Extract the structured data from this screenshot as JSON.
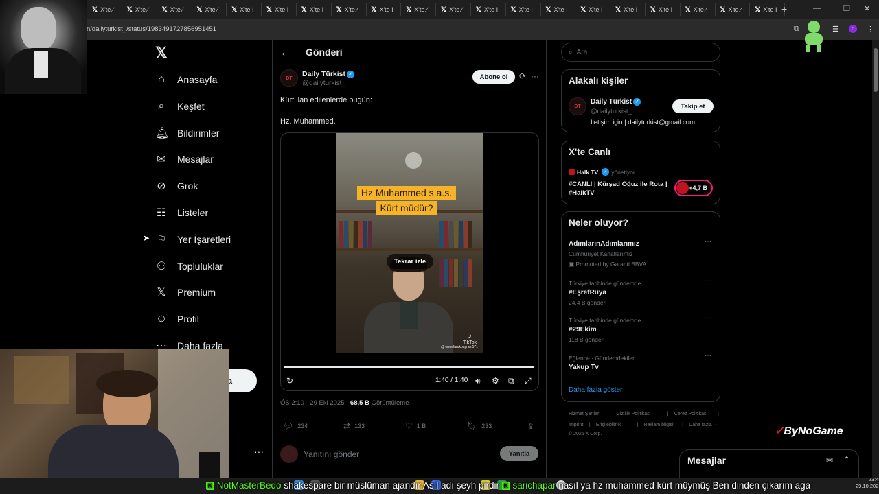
{
  "browser": {
    "tabs": [
      {
        "label": "X'te ∕"
      },
      {
        "label": "X'te ∕"
      },
      {
        "label": "X'te ∕"
      },
      {
        "label": "X'te ∕"
      },
      {
        "label": "X'te I"
      },
      {
        "label": "X'te I"
      },
      {
        "label": "X'te I"
      },
      {
        "label": "X'te ∕"
      },
      {
        "label": "X'te I"
      },
      {
        "label": "X'te ∕"
      },
      {
        "label": "X'te ∕"
      },
      {
        "label": "X'te I"
      },
      {
        "label": "X'te I"
      },
      {
        "label": "X'te I"
      },
      {
        "label": "X'te I"
      },
      {
        "label": "X'te I"
      },
      {
        "label": "X'te I"
      },
      {
        "label": "X'te ∕"
      },
      {
        "label": "X'te ∕"
      },
      {
        "label": "X'te I"
      }
    ],
    "url": "n/dailyturkist_/status/1983491727856951451"
  },
  "nav": {
    "items": [
      {
        "label": "Anasayfa",
        "icon": "home-icon"
      },
      {
        "label": "Keşfet",
        "icon": "search-icon"
      },
      {
        "label": "Bildirimler",
        "icon": "bell-icon"
      },
      {
        "label": "Mesajlar",
        "icon": "mail-icon"
      },
      {
        "label": "Grok",
        "icon": "grok-icon"
      },
      {
        "label": "Listeler",
        "icon": "list-icon"
      },
      {
        "label": "Yer İşaretleri",
        "icon": "bookmark-icon"
      },
      {
        "label": "Topluluklar",
        "icon": "people-icon"
      },
      {
        "label": "Premium",
        "icon": "x-icon"
      },
      {
        "label": "Profil",
        "icon": "person-icon"
      },
      {
        "label": "Daha fazla",
        "icon": "more-icon"
      }
    ],
    "post_button": "a",
    "more_dots": "···"
  },
  "main": {
    "title": "Gönderi",
    "author": {
      "name": "Daily Türkist",
      "handle": "@dailyturkist_",
      "avatar_text": "DT"
    },
    "subscribe": "Abone ol",
    "text_line1": "Kürt ilan edilenlerde bugün:",
    "text_line2": "Hz. Muhammed.",
    "video": {
      "caption_line1": "Hz Muhammed s.a.s.",
      "caption_line2": "Kürt müdür?",
      "replay_label": "Tekrar izle",
      "watermark": "TikTok",
      "watermark_user": "@ omerfarukbayram571",
      "timecode": "1:40 / 1:40",
      "progress": 1.0
    },
    "meta": {
      "time": "ÖS 2:10 · 29 Eki 2025 · ",
      "views": "68,5 B",
      "views_label": " Görüntüleme"
    },
    "actions": {
      "replies": "234",
      "reposts": "133",
      "likes": "1 B",
      "bookmarks": "233"
    },
    "reply_placeholder": "Yanıtını gönder",
    "reply_button": "Yanıtla"
  },
  "right": {
    "search_placeholder": "Ara",
    "related": {
      "title": "Alakalı kişiler",
      "name": "Daily Türkist",
      "handle": "@dailyturkist_",
      "bio": "İletişim için | dailyturkist@gmail.com",
      "follow": "Takip et",
      "avatar_text": "DT"
    },
    "live": {
      "title": "X'te Canlı",
      "host": "Halk TV",
      "host_role": "yönetiyor",
      "stream_title": "#CANLI | Kürşad Oğuz ile Rota | #HalkTV",
      "count": "+4,7 B"
    },
    "trends": {
      "title": "Neler oluyor?",
      "items": [
        {
          "meta": "",
          "name": "AdımlarınAdımlarımız",
          "sub": "Cumhuriyet Kanatlarımız",
          "promo": "Promoted by Garanti BBVA"
        },
        {
          "meta": "Türkiye tarihinde gündemde",
          "name": "#EşrefRüya",
          "sub": "24,4 B gönderi",
          "promo": ""
        },
        {
          "meta": "Türkiye tarihinde gündemde",
          "name": "#29Ekim",
          "sub": "118 B gönderi",
          "promo": ""
        },
        {
          "meta": "Eğlence · Gündemdekiler",
          "name": "Yakup Tv",
          "sub": "",
          "promo": ""
        }
      ],
      "show_more": "Daha fazla göster"
    },
    "footer": {
      "row1": [
        "Hizmet Şartları",
        "|",
        "Gizlilik Politikası",
        "|",
        "Çerez Politikası",
        "|"
      ],
      "row2": [
        "Imprint",
        "|",
        "Erişilebilirlik",
        "|",
        "Reklam bilgisi",
        "|",
        "Daha fazla ···"
      ],
      "copyright": "© 2025 X Corp."
    }
  },
  "messages": {
    "title": "Mesajlar"
  },
  "overlay": {
    "brand": "ByNoGame",
    "brand_mark": "✓"
  },
  "taskbar": {
    "time": "23:49",
    "date": "29.10.2025"
  },
  "ticker": {
    "user1": "NotMasterBedo",
    "msg1": " shakespare bir müslüman ajandır Asıl adı şeyh pirdir ",
    "user2": "sarichapar",
    "msg2": " nasıl ya hz muhammed kürt müymüş Ben dinden çıkarım aga"
  },
  "colors": {
    "accent": "#1d9bf0",
    "live": "#f91880",
    "kick": "#53fc18",
    "brand_red": "#e21b23"
  }
}
